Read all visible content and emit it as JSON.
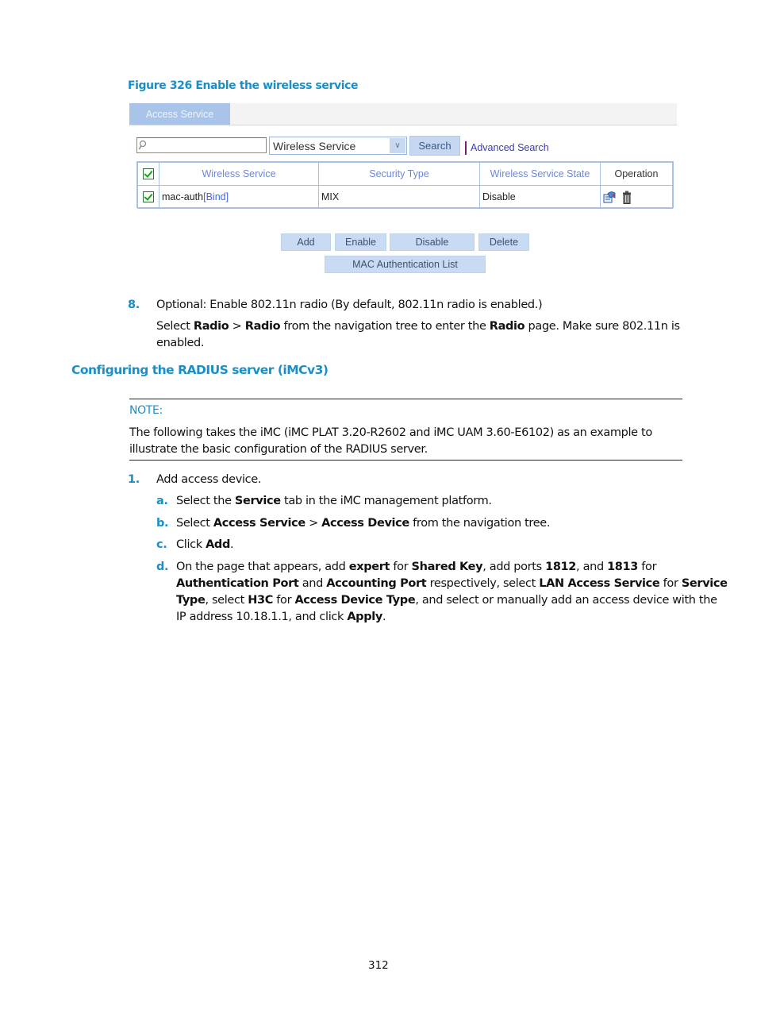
{
  "figure": {
    "caption": "Figure 326 Enable the wireless service",
    "tab_label": "Access Service",
    "search": {
      "input_value": "",
      "field_select_value": "Wireless Service",
      "search_button": "Search",
      "advanced_search_link": "Advanced Search"
    },
    "table": {
      "columns": [
        "Wireless Service",
        "Security Type",
        "Wireless Service State",
        "Operation"
      ],
      "header_checked": true,
      "rows": [
        {
          "checked": true,
          "wireless_service": "mac-auth",
          "bind_link": "[Bind]",
          "security_type": "MIX",
          "state": "Disable",
          "operations": [
            "edit-icon",
            "delete-icon"
          ]
        }
      ]
    },
    "buttons": {
      "add": "Add",
      "enable": "Enable",
      "disable": "Disable",
      "delete": "Delete",
      "mac_list": "MAC Authentication List"
    }
  },
  "step8": {
    "number": "8.",
    "text": "Optional: Enable 802.11n radio (By default, 802.11n radio is enabled.)",
    "detail": {
      "p1": "Select ",
      "b1": "Radio",
      "p2": " > ",
      "b2": "Radio",
      "p3": " from the navigation tree to enter the ",
      "b3": "Radio",
      "p4": " page. Make sure 802.11n is",
      "p5": "enabled."
    }
  },
  "section_heading": "Configuring the RADIUS server (iMCv3)",
  "note": {
    "label": "NOTE:",
    "line1": "The following takes the iMC (iMC PLAT 3.20-R2602 and iMC UAM 3.60-E6102) as an example to",
    "line2": "illustrate the basic configuration of the RADIUS server."
  },
  "step1": {
    "number": "1.",
    "text": "Add access device.",
    "substeps": {
      "a": {
        "label": "a.",
        "p1": "Select the ",
        "b1": "Service",
        "p2": " tab in the iMC management platform."
      },
      "b": {
        "label": "b.",
        "p1": "Select ",
        "b1": "Access Service",
        "p2": " > ",
        "b2": "Access Device",
        "p3": " from the navigation tree."
      },
      "c": {
        "label": "c.",
        "p1": "Click ",
        "b1": "Add",
        "p2": "."
      },
      "d": {
        "label": "d.",
        "l1": {
          "p1": "On the page that appears, add ",
          "b1": "expert",
          "p2": " for ",
          "b2": "Shared Key",
          "p3": ", add ports ",
          "b3": "1812",
          "p4": ", and ",
          "b4": "1813",
          "p5": " for"
        },
        "l2": {
          "b1": "Authentication Port",
          "p1": " and ",
          "b2": "Accounting Port",
          "p2": " respectively, select ",
          "b3": "LAN Access Service",
          "p3": " for ",
          "b4": "Service"
        },
        "l3": {
          "b1": "Type",
          "p1": ", select ",
          "b2": "H3C",
          "p2": " for ",
          "b3": "Access Device Type",
          "p3": ", and select or manually add an access device with the"
        },
        "l4": {
          "p1": "IP address 10.18.1.1, and click ",
          "b1": "Apply",
          "p2": "."
        }
      }
    }
  },
  "page_number": "312"
}
